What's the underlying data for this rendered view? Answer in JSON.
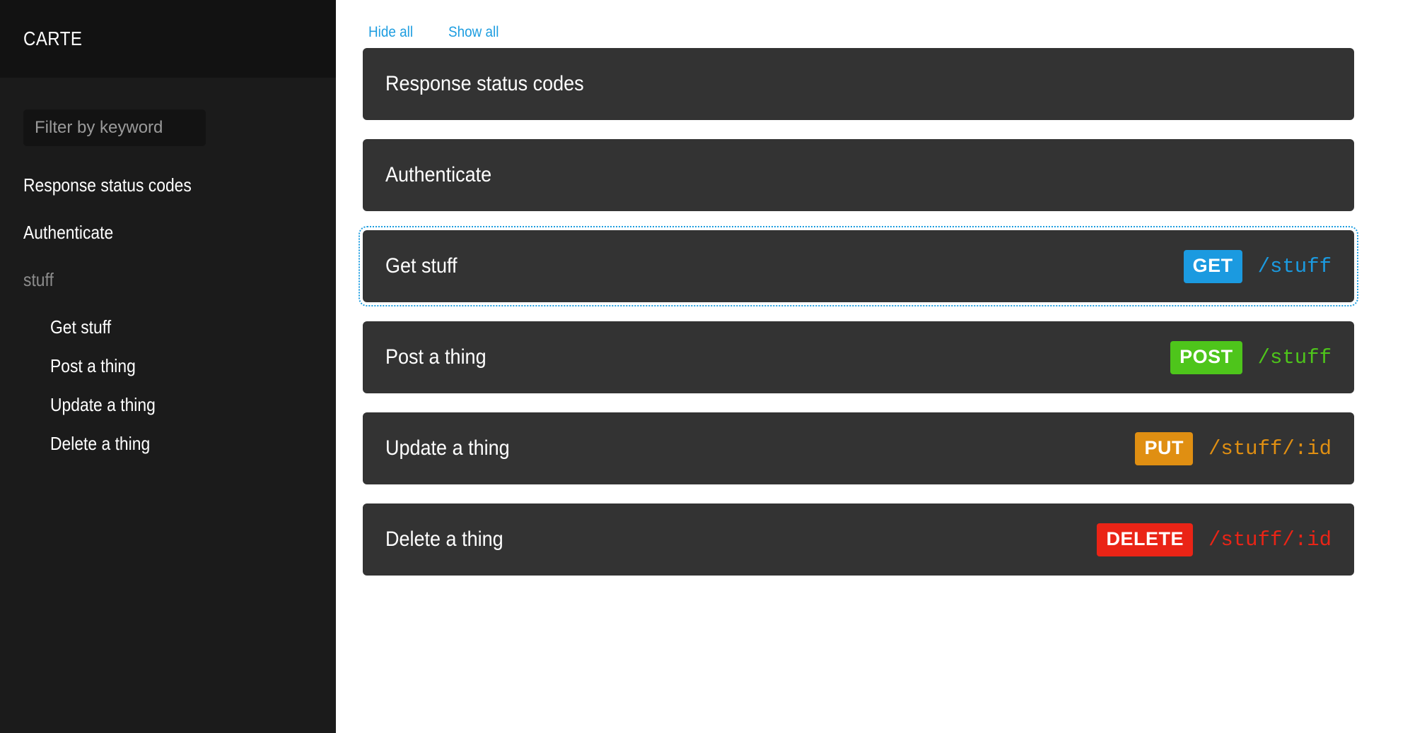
{
  "sidebar": {
    "brand": "CARTE",
    "filter": {
      "placeholder": "Filter by keyword",
      "value": ""
    },
    "nav": [
      {
        "label": "Response status codes",
        "type": "item"
      },
      {
        "label": "Authenticate",
        "type": "item"
      },
      {
        "label": "stuff",
        "type": "group"
      },
      {
        "label": "Get stuff",
        "type": "child"
      },
      {
        "label": "Post a thing",
        "type": "child"
      },
      {
        "label": "Update a thing",
        "type": "child"
      },
      {
        "label": "Delete a thing",
        "type": "child"
      }
    ]
  },
  "toolbar": {
    "hide_all": "Hide all",
    "show_all": "Show all"
  },
  "colors": {
    "link": "#1d9de0",
    "card": "#333333",
    "sidebar": "#1b1b1b",
    "sidebar_header": "#121212",
    "get": "#1b9ae0",
    "post": "#4ec51b",
    "put": "#e08f12",
    "delete": "#ea2416"
  },
  "endpoints": [
    {
      "title": "Response status codes",
      "verb": "",
      "path": "",
      "focused": false
    },
    {
      "title": "Authenticate",
      "verb": "",
      "path": "",
      "focused": false
    },
    {
      "title": "Get stuff",
      "verb": "GET",
      "path": "/stuff",
      "color": "#1b9ae0",
      "focused": true
    },
    {
      "title": "Post a thing",
      "verb": "POST",
      "path": "/stuff",
      "color": "#4ec51b",
      "focused": false
    },
    {
      "title": "Update a thing",
      "verb": "PUT",
      "path": "/stuff/:id",
      "color": "#e08f12",
      "focused": false
    },
    {
      "title": "Delete a thing",
      "verb": "DELETE",
      "path": "/stuff/:id",
      "color": "#ea2416",
      "focused": false
    }
  ]
}
